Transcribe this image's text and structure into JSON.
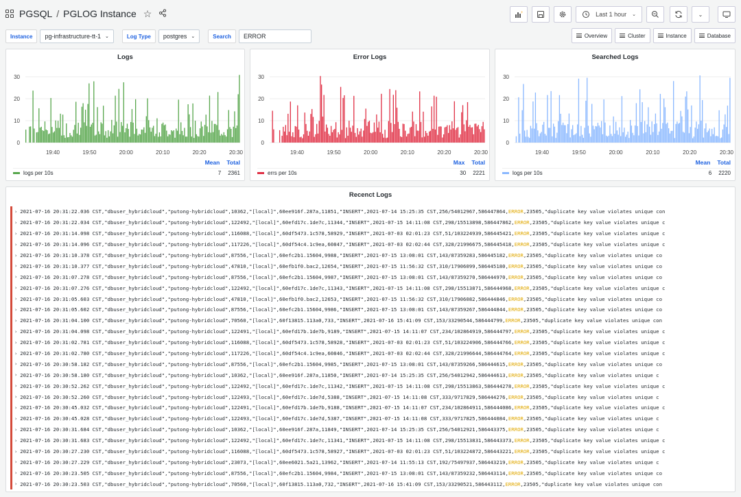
{
  "breadcrumb": {
    "folder": "PGSQL",
    "separator": "/",
    "title": "PGLOG Instance"
  },
  "toolbar": {
    "time_range": "Last 1 hour"
  },
  "variables": [
    {
      "label": "Instance",
      "value": "pg-infrastructure-tt-1",
      "type": "select"
    },
    {
      "label": "Log Type",
      "value": "postgres",
      "type": "select"
    },
    {
      "label": "Search",
      "value": "ERROR",
      "type": "text"
    }
  ],
  "links": [
    "Overview",
    "Cluster",
    "Instance",
    "Database"
  ],
  "colors": {
    "logs": "#56a64b",
    "errors": "#e02f44",
    "searched": "#8ab8ff",
    "accent": "#1f62e0",
    "error_text": "#e0a800"
  },
  "panels": [
    {
      "title": "Logs",
      "legend_headers": [
        "Mean",
        "Total"
      ],
      "legend_series": "logs per 10s",
      "legend_values": [
        "7",
        "2361"
      ]
    },
    {
      "title": "Error Logs",
      "legend_headers": [
        "Max",
        "Total"
      ],
      "legend_series": "errs per 10s",
      "legend_values": [
        "30",
        "2221"
      ]
    },
    {
      "title": "Searched Logs",
      "legend_headers": [
        "Mean",
        "Total"
      ],
      "legend_series": "logs per 10s",
      "legend_values": [
        "6",
        "2220"
      ]
    }
  ],
  "chart_data": [
    {
      "type": "bar",
      "title": "Logs",
      "series": [
        {
          "name": "logs per 10s"
        }
      ],
      "x_ticks": [
        "19:40",
        "19:50",
        "20:00",
        "20:10",
        "20:20",
        "20:30"
      ],
      "ylim": [
        0,
        30
      ],
      "y_ticks": [
        "0",
        "10",
        "20",
        "30"
      ],
      "legend": "bottom"
    },
    {
      "type": "bar",
      "title": "Error Logs",
      "series": [
        {
          "name": "errs per 10s"
        }
      ],
      "x_ticks": [
        "19:40",
        "19:50",
        "20:00",
        "20:10",
        "20:20",
        "20:30"
      ],
      "ylim": [
        0,
        30
      ],
      "y_ticks": [
        "0",
        "10",
        "20",
        "30"
      ],
      "legend": "bottom"
    },
    {
      "type": "bar",
      "title": "Searched Logs",
      "series": [
        {
          "name": "logs per 10s"
        }
      ],
      "x_ticks": [
        "19:40",
        "19:50",
        "20:00",
        "20:10",
        "20:20",
        "20:30"
      ],
      "ylim": [
        0,
        30
      ],
      "y_ticks": [
        "0",
        "10",
        "20",
        "30"
      ],
      "legend": "bottom"
    }
  ],
  "logs_panel": {
    "title": "Recenct Logs",
    "rows": [
      {
        "pre": "2021-07-16 20:31:22.036 CST,\"dbuser_hybridcloud\",\"putong-hybridcloud\",10362,\"[local]\",60ee916f.287a,11851,\"INSERT\",2021-07-14 15:25:35 CST,256/54012967,586447864,",
        "level": "ERROR",
        "post": ",23505,\"duplicate key value violates unique con"
      },
      {
        "pre": "2021-07-16 20:31:22.034 CST,\"dbuser_hybridcloud\",\"putong-hybridcloud\",122492,\"[local]\",60efd17c.1de7c,11344,\"INSERT\",2021-07-15 14:11:08 CST,298/15513898,586447862,",
        "level": "ERROR",
        "post": ",23505,\"duplicate key value violates unique c"
      },
      {
        "pre": "2021-07-16 20:31:14.098 CST,\"dbuser_hybridcloud\",\"putong-hybridcloud\",116088,\"[local]\",60df5473.1c578,58929,\"INSERT\",2021-07-03 02:01:23 CST,51/103224939,586445421,",
        "level": "ERROR",
        "post": ",23505,\"duplicate key value violates unique c"
      },
      {
        "pre": "2021-07-16 20:31:14.096 CST,\"dbuser_hybridcloud\",\"putong-hybridcloud\",117226,\"[local]\",60df54c4.1c9ea,60847,\"INSERT\",2021-07-03 02:02:44 CST,328/21996675,586445418,",
        "level": "ERROR",
        "post": ",23505,\"duplicate key value violates unique c"
      },
      {
        "pre": "2021-07-16 20:31:10.378 CST,\"dbuser_hybridcloud\",\"putong-hybridcloud\",87556,\"[local]\",60efc2b1.15604,9988,\"INSERT\",2021-07-15 13:08:01 CST,143/87359283,586445182,",
        "level": "ERROR",
        "post": ",23505,\"duplicate key value violates unique co"
      },
      {
        "pre": "2021-07-16 20:31:10.377 CST,\"dbuser_hybridcloud\",\"putong-hybridcloud\",47810,\"[local]\",60efb1f0.bac2,12654,\"INSERT\",2021-07-15 11:56:32 CST,310/17906099,586445180,",
        "level": "ERROR",
        "post": ",23505,\"duplicate key value violates unique co"
      },
      {
        "pre": "2021-07-16 20:31:07.278 CST,\"dbuser_hybridcloud\",\"putong-hybridcloud\",87556,\"[local]\",60efc2b1.15604,9987,\"INSERT\",2021-07-15 13:08:01 CST,143/87359270,586444970,",
        "level": "ERROR",
        "post": ",23505,\"duplicate key value violates unique co"
      },
      {
        "pre": "2021-07-16 20:31:07.276 CST,\"dbuser_hybridcloud\",\"putong-hybridcloud\",122492,\"[local]\",60efd17c.1de7c,11343,\"INSERT\",2021-07-15 14:11:08 CST,298/15513871,586444968,",
        "level": "ERROR",
        "post": ",23505,\"duplicate key value violates unique c"
      },
      {
        "pre": "2021-07-16 20:31:05.603 CST,\"dbuser_hybridcloud\",\"putong-hybridcloud\",47810,\"[local]\",60efb1f0.bac2,12653,\"INSERT\",2021-07-15 11:56:32 CST,310/17906082,586444846,",
        "level": "ERROR",
        "post": ",23505,\"duplicate key value violates unique co"
      },
      {
        "pre": "2021-07-16 20:31:05.602 CST,\"dbuser_hybridcloud\",\"putong-hybridcloud\",87556,\"[local]\",60efc2b1.15604,9986,\"INSERT\",2021-07-15 13:08:01 CST,143/87359267,586444844,",
        "level": "ERROR",
        "post": ",23505,\"duplicate key value violates unique co"
      },
      {
        "pre": "2021-07-16 20:31:04.100 CST,\"dbuser_hybridcloud\",\"putong-hybridcloud\",70560,\"[local]\",60f13815.113a0,733,\"INSERT\",2021-07-16 15:41:09 CST,153/33290544,586444799,",
        "level": "ERROR",
        "post": ",23505,\"duplicate key value violates unique con"
      },
      {
        "pre": "2021-07-16 20:31:04.098 CST,\"dbuser_hybridcloud\",\"putong-hybridcloud\",122491,\"[local]\",60efd17b.1de7b,9189,\"INSERT\",2021-07-15 14:11:07 CST,234/102864919,586444797,",
        "level": "ERROR",
        "post": ",23505,\"duplicate key value violates unique c"
      },
      {
        "pre": "2021-07-16 20:31:02.781 CST,\"dbuser_hybridcloud\",\"putong-hybridcloud\",116088,\"[local]\",60df5473.1c578,58928,\"INSERT\",2021-07-03 02:01:23 CST,51/103224906,586444766,",
        "level": "ERROR",
        "post": ",23505,\"duplicate key value violates unique c"
      },
      {
        "pre": "2021-07-16 20:31:02.780 CST,\"dbuser_hybridcloud\",\"putong-hybridcloud\",117226,\"[local]\",60df54c4.1c9ea,60846,\"INSERT\",2021-07-03 02:02:44 CST,328/21996644,586444764,",
        "level": "ERROR",
        "post": ",23505,\"duplicate key value violates unique c"
      },
      {
        "pre": "2021-07-16 20:30:58.182 CST,\"dbuser_hybridcloud\",\"putong-hybridcloud\",87556,\"[local]\",60efc2b1.15604,9985,\"INSERT\",2021-07-15 13:08:01 CST,143/87359266,586444615,",
        "level": "ERROR",
        "post": ",23505,\"duplicate key value violates unique co"
      },
      {
        "pre": "2021-07-16 20:30:58.180 CST,\"dbuser_hybridcloud\",\"putong-hybridcloud\",10362,\"[local]\",60ee916f.287a,11850,\"INSERT\",2021-07-14 15:25:35 CST,256/54012942,586444613,",
        "level": "ERROR",
        "post": ",23505,\"duplicate key value violates unique c"
      },
      {
        "pre": "2021-07-16 20:30:52.262 CST,\"dbuser_hybridcloud\",\"putong-hybridcloud\",122492,\"[local]\",60efd17c.1de7c,11342,\"INSERT\",2021-07-15 14:11:08 CST,298/15513863,586444278,",
        "level": "ERROR",
        "post": ",23505,\"duplicate key value violates unique c"
      },
      {
        "pre": "2021-07-16 20:30:52.260 CST,\"dbuser_hybridcloud\",\"putong-hybridcloud\",122493,\"[local]\",60efd17c.1de7d,5388,\"INSERT\",2021-07-15 14:11:08 CST,333/9717829,586444276,",
        "level": "ERROR",
        "post": ",23505,\"duplicate key value violates unique c"
      },
      {
        "pre": "2021-07-16 20:30:45.032 CST,\"dbuser_hybridcloud\",\"putong-hybridcloud\",122491,\"[local]\",60efd17b.1de7b,9188,\"INSERT\",2021-07-15 14:11:07 CST,234/102864911,586444086,",
        "level": "ERROR",
        "post": ",23505,\"duplicate key value violates unique c"
      },
      {
        "pre": "2021-07-16 20:30:45.028 CST,\"dbuser_hybridcloud\",\"putong-hybridcloud\",122493,\"[local]\",60efd17c.1de7d,5387,\"INSERT\",2021-07-15 14:11:08 CST,333/9717825,586444084,",
        "level": "ERROR",
        "post": ",23505,\"duplicate key value violates unique c"
      },
      {
        "pre": "2021-07-16 20:30:31.684 CST,\"dbuser_hybridcloud\",\"putong-hybridcloud\",10362,\"[local]\",60ee916f.287a,11849,\"INSERT\",2021-07-14 15:25:35 CST,256/54012921,586443375,",
        "level": "ERROR",
        "post": ",23505,\"duplicate key value violates unique c"
      },
      {
        "pre": "2021-07-16 20:30:31.683 CST,\"dbuser_hybridcloud\",\"putong-hybridcloud\",122492,\"[local]\",60efd17c.1de7c,11341,\"INSERT\",2021-07-15 14:11:08 CST,298/15513831,586443373,",
        "level": "ERROR",
        "post": ",23505,\"duplicate key value violates unique c"
      },
      {
        "pre": "2021-07-16 20:30:27.230 CST,\"dbuser_hybridcloud\",\"putong-hybridcloud\",116088,\"[local]\",60df5473.1c578,58927,\"INSERT\",2021-07-03 02:01:23 CST,51/103224872,586443221,",
        "level": "ERROR",
        "post": ",23505,\"duplicate key value violates unique c"
      },
      {
        "pre": "2021-07-16 20:30:27.229 CST,\"dbuser_hybridcloud\",\"putong-hybridcloud\",23073,\"[local]\",60ee6021.5a21,13962,\"INSERT\",2021-07-14 11:55:13 CST,192/75497937,586443219,",
        "level": "ERROR",
        "post": ",23505,\"duplicate key value violates unique c"
      },
      {
        "pre": "2021-07-16 20:30:23.505 CST,\"dbuser_hybridcloud\",\"putong-hybridcloud\",87556,\"[local]\",60efc2b1.15604,9984,\"INSERT\",2021-07-15 13:08:01 CST,143/87359232,586443114,",
        "level": "ERROR",
        "post": ",23505,\"duplicate key value violates unique co"
      },
      {
        "pre": "2021-07-16 20:30:23.503 CST,\"dbuser_hybridcloud\",\"putong-hybridcloud\",70560,\"[local]\",60f13815.113a0,732,\"INSERT\",2021-07-16 15:41:09 CST,153/33290521,586443112,",
        "level": "ERROR",
        "post": ",23505,\"duplicate key value violates unique con"
      }
    ]
  }
}
